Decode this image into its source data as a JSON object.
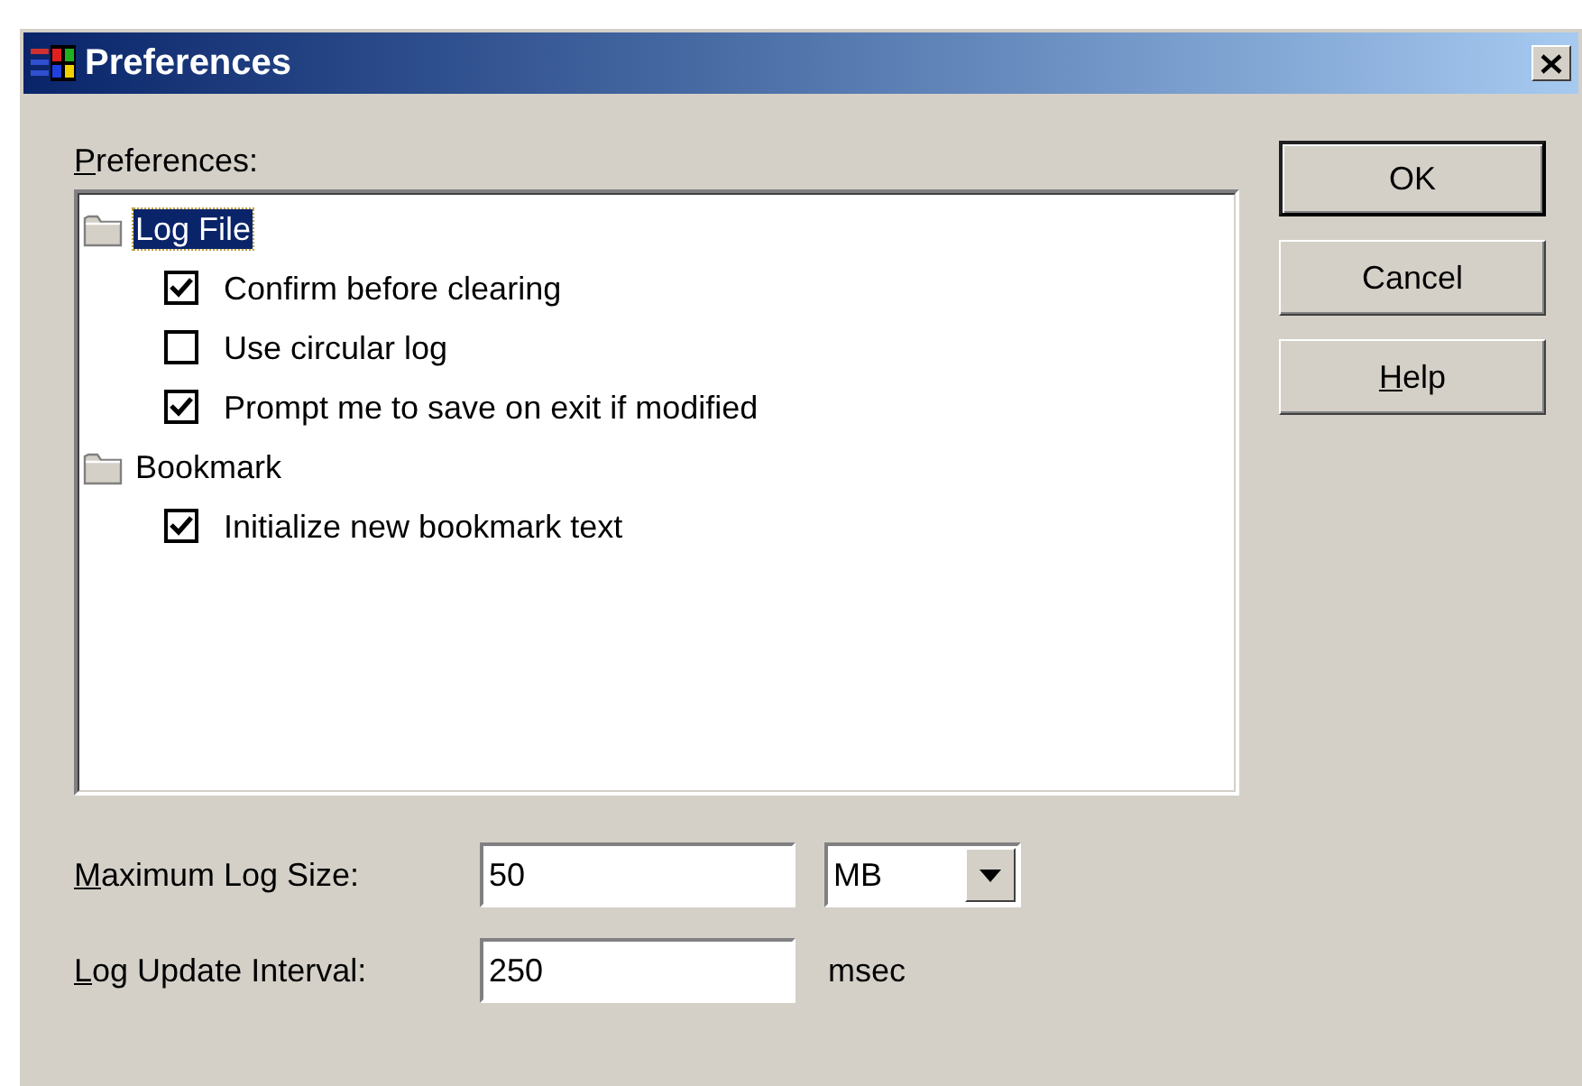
{
  "window": {
    "title": "Preferences"
  },
  "tree": {
    "label": "Preferences:",
    "underline_first": true,
    "groups": [
      {
        "label": "Log File",
        "selected": true,
        "children": [
          {
            "label": "Confirm before clearing",
            "checked": true
          },
          {
            "label": "Use circular log",
            "checked": false
          },
          {
            "label": "Prompt me to save on exit if modified",
            "checked": true
          }
        ]
      },
      {
        "label": "Bookmark",
        "selected": false,
        "children": [
          {
            "label": "Initialize new bookmark text",
            "checked": true
          }
        ]
      }
    ]
  },
  "fields": [
    {
      "label": "Maximum Log Size:",
      "underline_first": true,
      "value": "50",
      "kind": "combo",
      "unit": "MB"
    },
    {
      "label": "Log Update Interval:",
      "underline_first": true,
      "value": "250",
      "kind": "text",
      "unit": "msec"
    }
  ],
  "buttons": [
    {
      "label": "OK",
      "default": true,
      "underline_first": false
    },
    {
      "label": "Cancel",
      "default": false,
      "underline_first": false
    },
    {
      "label": "Help",
      "default": false,
      "underline_first": true
    }
  ]
}
